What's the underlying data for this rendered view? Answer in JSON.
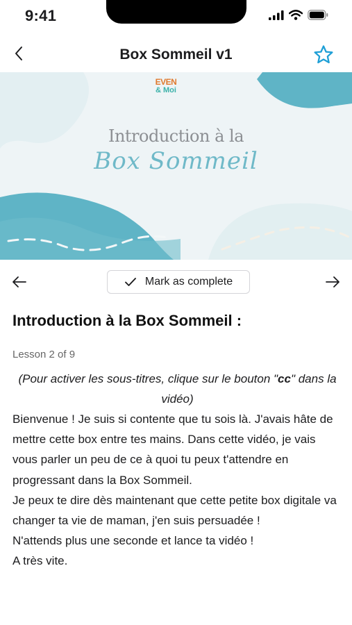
{
  "status_bar": {
    "time": "9:41"
  },
  "nav": {
    "title": "Box Sommeil v1",
    "back_icon": "chevron-left-icon",
    "favorite_icon": "star-outline-icon"
  },
  "video": {
    "logo_line1": "EVEN",
    "logo_line2": "& Moi",
    "title": "Introduction à la",
    "script_title": "Box Sommeil",
    "colors": {
      "teal": "#5fb4c6",
      "light_teal": "#d8ecef",
      "background": "#eef4f6"
    }
  },
  "lesson_controls": {
    "complete_label": "Mark as complete",
    "prev_icon": "arrow-left-icon",
    "next_icon": "arrow-right-icon"
  },
  "lesson": {
    "heading": "Introduction à la Box Sommeil :",
    "progress": "Lesson 2 of 9",
    "note_before": "(Pour activer les sous-titres, clique sur le bouton \"",
    "note_bold": "cc",
    "note_after": "\" dans la vidéo)",
    "paragraphs": [
      "Bienvenue ! Je suis si contente que tu sois là. J'avais hâte de mettre cette box entre tes mains. Dans cette vidéo, je vais vous parler un peu de ce à quoi tu peux t'attendre en progressant dans la Box Sommeil.",
      "Je peux te dire dès maintenant que cette petite box digitale va changer ta vie de maman, j'en suis persuadée !",
      "N'attends plus une seconde et lance ta vidéo !",
      "A très vite."
    ]
  }
}
